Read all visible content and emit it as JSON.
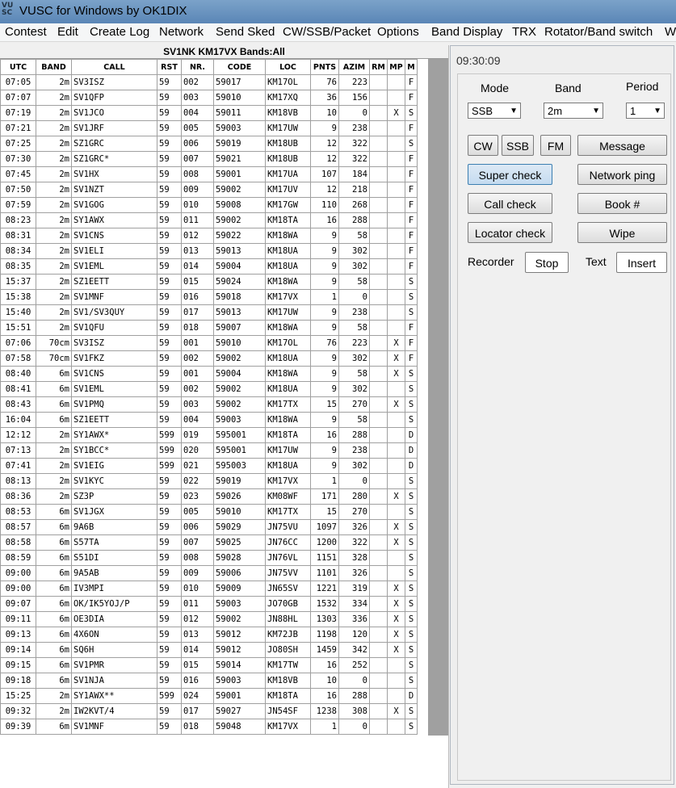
{
  "app": {
    "icon_text": "VU\nSC",
    "title": "VUSC for Windows by OK1DIX"
  },
  "menu": [
    "Contest",
    "Edit",
    "Create Log",
    "Network",
    "Send Sked",
    "CW/SSB/Packet",
    "Options",
    "Band Display",
    "TRX",
    "Rotator/Band switch",
    "W"
  ],
  "log": {
    "header": "SV1NK  KM17VX  Bands:All",
    "columns": [
      "UTC",
      "BAND",
      "CALL",
      "RST",
      "NR.",
      "CODE",
      "LOC",
      "PNTS",
      "AZIM",
      "RM",
      "MP",
      "M"
    ],
    "rows": [
      [
        "07:05",
        "2m",
        "SV3ISZ",
        "59",
        "002",
        "59017",
        "KM17OL",
        "76",
        "223",
        "",
        "",
        "F"
      ],
      [
        "07:07",
        "2m",
        "SV1QFP",
        "59",
        "003",
        "59010",
        "KM17XQ",
        "36",
        "156",
        "",
        "",
        "F"
      ],
      [
        "07:19",
        "2m",
        "SV1JCO",
        "59",
        "004",
        "59011",
        "KM18VB",
        "10",
        "0",
        "",
        "X",
        "S"
      ],
      [
        "07:21",
        "2m",
        "SV1JRF",
        "59",
        "005",
        "59003",
        "KM17UW",
        "9",
        "238",
        "",
        "",
        "F"
      ],
      [
        "07:25",
        "2m",
        "SZ1GRC",
        "59",
        "006",
        "59019",
        "KM18UB",
        "12",
        "322",
        "",
        "",
        "S"
      ],
      [
        "07:30",
        "2m",
        "SZ1GRC*",
        "59",
        "007",
        "59021",
        "KM18UB",
        "12",
        "322",
        "",
        "",
        "F"
      ],
      [
        "07:45",
        "2m",
        "SV1HX",
        "59",
        "008",
        "59001",
        "KM17UA",
        "107",
        "184",
        "",
        "",
        "F"
      ],
      [
        "07:50",
        "2m",
        "SV1NZT",
        "59",
        "009",
        "59002",
        "KM17UV",
        "12",
        "218",
        "",
        "",
        "F"
      ],
      [
        "07:59",
        "2m",
        "SV1GOG",
        "59",
        "010",
        "59008",
        "KM17GW",
        "110",
        "268",
        "",
        "",
        "F"
      ],
      [
        "08:23",
        "2m",
        "SY1AWX",
        "59",
        "011",
        "59002",
        "KM18TA",
        "16",
        "288",
        "",
        "",
        "F"
      ],
      [
        "08:31",
        "2m",
        "SV1CNS",
        "59",
        "012",
        "59022",
        "KM18WA",
        "9",
        "58",
        "",
        "",
        "F"
      ],
      [
        "08:34",
        "2m",
        "SV1ELI",
        "59",
        "013",
        "59013",
        "KM18UA",
        "9",
        "302",
        "",
        "",
        "F"
      ],
      [
        "08:35",
        "2m",
        "SV1EML",
        "59",
        "014",
        "59004",
        "KM18UA",
        "9",
        "302",
        "",
        "",
        "F"
      ],
      [
        "15:37",
        "2m",
        "SZ1EETT",
        "59",
        "015",
        "59024",
        "KM18WA",
        "9",
        "58",
        "",
        "",
        "S"
      ],
      [
        "15:38",
        "2m",
        "SV1MNF",
        "59",
        "016",
        "59018",
        "KM17VX",
        "1",
        "0",
        "",
        "",
        "S"
      ],
      [
        "15:40",
        "2m",
        "SV1/SV3QUY",
        "59",
        "017",
        "59013",
        "KM17UW",
        "9",
        "238",
        "",
        "",
        "S"
      ],
      [
        "15:51",
        "2m",
        "SV1QFU",
        "59",
        "018",
        "59007",
        "KM18WA",
        "9",
        "58",
        "",
        "",
        "F"
      ],
      [
        "07:06",
        "70cm",
        "SV3ISZ",
        "59",
        "001",
        "59010",
        "KM17OL",
        "76",
        "223",
        "",
        "X",
        "F"
      ],
      [
        "07:58",
        "70cm",
        "SV1FKZ",
        "59",
        "002",
        "59002",
        "KM18UA",
        "9",
        "302",
        "",
        "X",
        "F"
      ],
      [
        "08:40",
        "6m",
        "SV1CNS",
        "59",
        "001",
        "59004",
        "KM18WA",
        "9",
        "58",
        "",
        "X",
        "S"
      ],
      [
        "08:41",
        "6m",
        "SV1EML",
        "59",
        "002",
        "59002",
        "KM18UA",
        "9",
        "302",
        "",
        "",
        "S"
      ],
      [
        "08:43",
        "6m",
        "SV1PMQ",
        "59",
        "003",
        "59002",
        "KM17TX",
        "15",
        "270",
        "",
        "X",
        "S"
      ],
      [
        "16:04",
        "6m",
        "SZ1EETT",
        "59",
        "004",
        "59003",
        "KM18WA",
        "9",
        "58",
        "",
        "",
        "S"
      ],
      [
        "12:12",
        "2m",
        "SY1AWX*",
        "599",
        "019",
        "595001",
        "KM18TA",
        "16",
        "288",
        "",
        "",
        "D"
      ],
      [
        "07:13",
        "2m",
        "SY1BCC*",
        "599",
        "020",
        "595001",
        "KM17UW",
        "9",
        "238",
        "",
        "",
        "D"
      ],
      [
        "07:41",
        "2m",
        "SV1EIG",
        "599",
        "021",
        "595003",
        "KM18UA",
        "9",
        "302",
        "",
        "",
        "D"
      ],
      [
        "08:13",
        "2m",
        "SV1KYC",
        "59",
        "022",
        "59019",
        "KM17VX",
        "1",
        "0",
        "",
        "",
        "S"
      ],
      [
        "08:36",
        "2m",
        "SZ3P",
        "59",
        "023",
        "59026",
        "KM08WF",
        "171",
        "280",
        "",
        "X",
        "S"
      ],
      [
        "08:53",
        "6m",
        "SV1JGX",
        "59",
        "005",
        "59010",
        "KM17TX",
        "15",
        "270",
        "",
        "",
        "S"
      ],
      [
        "08:57",
        "6m",
        "9A6B",
        "59",
        "006",
        "59029",
        "JN75VU",
        "1097",
        "326",
        "",
        "X",
        "S"
      ],
      [
        "08:58",
        "6m",
        "S57TA",
        "59",
        "007",
        "59025",
        "JN76CC",
        "1200",
        "322",
        "",
        "X",
        "S"
      ],
      [
        "08:59",
        "6m",
        "S51DI",
        "59",
        "008",
        "59028",
        "JN76VL",
        "1151",
        "328",
        "",
        "",
        "S"
      ],
      [
        "09:00",
        "6m",
        "9A5AB",
        "59",
        "009",
        "59006",
        "JN75VV",
        "1101",
        "326",
        "",
        "",
        "S"
      ],
      [
        "09:00",
        "6m",
        "IV3MPI",
        "59",
        "010",
        "59009",
        "JN65SV",
        "1221",
        "319",
        "",
        "X",
        "S"
      ],
      [
        "09:07",
        "6m",
        "OK/IK5YOJ/P",
        "59",
        "011",
        "59003",
        "JO70GB",
        "1532",
        "334",
        "",
        "X",
        "S"
      ],
      [
        "09:11",
        "6m",
        "OE3DIA",
        "59",
        "012",
        "59002",
        "JN88HL",
        "1303",
        "336",
        "",
        "X",
        "S"
      ],
      [
        "09:13",
        "6m",
        "4X6ON",
        "59",
        "013",
        "59012",
        "KM72JB",
        "1198",
        "120",
        "",
        "X",
        "S"
      ],
      [
        "09:14",
        "6m",
        "SQ6H",
        "59",
        "014",
        "59012",
        "JO80SH",
        "1459",
        "342",
        "",
        "X",
        "S"
      ],
      [
        "09:15",
        "6m",
        "SV1PMR",
        "59",
        "015",
        "59014",
        "KM17TW",
        "16",
        "252",
        "",
        "",
        "S"
      ],
      [
        "09:18",
        "6m",
        "SV1NJA",
        "59",
        "016",
        "59003",
        "KM18VB",
        "10",
        "0",
        "",
        "",
        "S"
      ],
      [
        "15:25",
        "2m",
        "SY1AWX**",
        "599",
        "024",
        "59001",
        "KM18TA",
        "16",
        "288",
        "",
        "",
        "D"
      ],
      [
        "09:32",
        "2m",
        "IW2KVT/4",
        "59",
        "017",
        "59027",
        "JN54SF",
        "1238",
        "308",
        "",
        "X",
        "S"
      ],
      [
        "09:39",
        "6m",
        "SV1MNF",
        "59",
        "018",
        "59048",
        "KM17VX",
        "1",
        "0",
        "",
        "",
        "S"
      ]
    ]
  },
  "side": {
    "clock": "09:30:09",
    "mode_label": "Mode",
    "band_label": "Band",
    "period_label": "Period",
    "mode_value": "SSB",
    "band_value": "2m",
    "period_value": "1",
    "cw": "CW",
    "ssb": "SSB",
    "fm": "FM",
    "message": "Message",
    "super_check": "Super check",
    "network_ping": "Network ping",
    "call_check": "Call check",
    "book": "Book #",
    "locator_check": "Locator check",
    "wipe": "Wipe",
    "recorder_label": "Recorder",
    "stop": "Stop",
    "text_label": "Text",
    "insert": "Insert"
  },
  "colors": {
    "titlebar": "#5a86b6",
    "scrollbar": "#a0a0a0",
    "active_button": "#c4dbf0"
  },
  "icons": {
    "dropdown": "chevron-down-icon",
    "app": "vusc-app-icon"
  }
}
